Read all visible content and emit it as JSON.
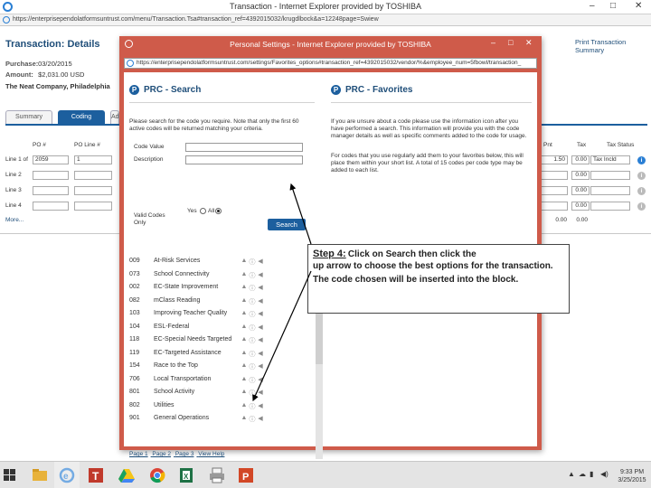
{
  "ie_window": {
    "title": "Transaction - Internet Explorer provided by TOSHIBA",
    "url": "https://enterprisependolatformsuntrust.com/menu/Transaction.Tsa#transaction_ref=4392015032/krugdlbock&a=12248page=Swiew",
    "win_buttons": [
      "–",
      "□",
      "✕"
    ]
  },
  "background_page": {
    "heading": "Transaction: Details",
    "print_link": "Print Transaction Summary",
    "purchase_label": "Purchase:",
    "purchase_value": "03/20/2015",
    "amount_label": "Amount:",
    "amount_value": "$2,031.00 USD",
    "company": "The Neat Company, Philadelphia",
    "tabs": [
      "Summary",
      "Coding",
      "Ad"
    ],
    "columns_left": [
      "PO #",
      "PO Line #"
    ],
    "columns_right": [
      "Pnt",
      "Tax",
      "Tax Status"
    ],
    "lines": [
      {
        "label": "Line 1 of",
        "po": "2059",
        "po_line": "1",
        "amt": "1.50",
        "tax": "0.00",
        "status": "Tax Incld"
      },
      {
        "label": "Line 2",
        "po": "",
        "po_line": "",
        "amt": "",
        "tax": "0.00",
        "status": ""
      },
      {
        "label": "Line 3",
        "po": "",
        "po_line": "",
        "amt": "",
        "tax": "0.00",
        "status": ""
      },
      {
        "label": "Line 4",
        "po": "",
        "po_line": "",
        "amt": "",
        "tax": "0.00",
        "status": ""
      }
    ],
    "totals": {
      "amt": "0.00",
      "tax": "0.00"
    },
    "more_link": "More..."
  },
  "popup": {
    "title": "Personal Settings - Internet Explorer provided by TOSHIBA",
    "url": "https://enterprisependolatformsuntrust.com/settings/Favorites_options#transaction_ref=4392015032/vendor/%&employee_num=5fbowl/transaction_",
    "win_buttons": [
      "–",
      "□",
      "✕"
    ],
    "search": {
      "title": "PRC - Search",
      "intro": "Please search for the code you require. Note that only the first 60 active codes will be returned matching your criteria.",
      "code_value_label": "Code Value",
      "description_label": "Description",
      "valid_codes_label": "Valid Codes Only",
      "yes_label": "Yes",
      "all_label": "All",
      "button_label": "Search"
    },
    "favorites": {
      "title": "PRC - Favorites",
      "para1": "If you are unsure about a code please use the information icon after you have performed a search. This information will provide you with the code manager details as well as specific comments added to the code for usage.",
      "para2": "For codes that you use regularly add them to your favorites below, this will place them within your short list. A total of 15 codes per code type may be added to each list."
    },
    "codes": [
      {
        "code": "009",
        "desc": "At-Risk Services"
      },
      {
        "code": "073",
        "desc": "School Connectivity"
      },
      {
        "code": "002",
        "desc": "EC-State Improvement"
      },
      {
        "code": "082",
        "desc": "mClass Reading"
      },
      {
        "code": "103",
        "desc": "Improving Teacher Quality"
      },
      {
        "code": "104",
        "desc": "ESL-Federal"
      },
      {
        "code": "118",
        "desc": "EC-Special Needs Targeted"
      },
      {
        "code": "119",
        "desc": "EC-Targeted Assistance"
      },
      {
        "code": "154",
        "desc": "Race to the Top"
      },
      {
        "code": "706",
        "desc": "Local Transportation"
      },
      {
        "code": "801",
        "desc": "School Activity"
      },
      {
        "code": "802",
        "desc": "Utilities"
      },
      {
        "code": "901",
        "desc": "General Operations"
      }
    ],
    "pager_links": [
      "Page 1",
      "Page 2",
      "Page 3",
      "View Help"
    ]
  },
  "callout": {
    "step_label": "Step 4:",
    "text_line1": "Click on Search then click the",
    "text_rest": "up arrow to choose the best options for the transaction.  The code chosen will be inserted into the block."
  },
  "taskbar": {
    "time": "9:33 PM",
    "date": "3/25/2015",
    "apps": [
      "file-explorer",
      "internet-explorer",
      "toggl",
      "google-drive",
      "chrome",
      "excel",
      "printer",
      "powerpoint"
    ]
  },
  "colors": {
    "popup_frame": "#cf5b4a",
    "accent_blue": "#1c5f9e",
    "heading_blue": "#1f4e79"
  }
}
